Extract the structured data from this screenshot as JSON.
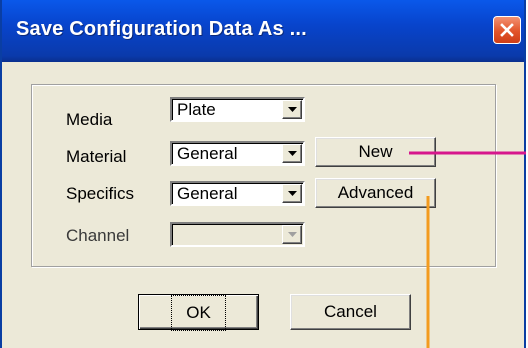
{
  "window": {
    "title": "Save Configuration Data As ..."
  },
  "form": {
    "media": {
      "label": "Media",
      "value": "Plate"
    },
    "material": {
      "label": "Material",
      "value": "General"
    },
    "specifics": {
      "label": "Specifics",
      "value": "General"
    },
    "channel": {
      "label": "Channel",
      "value": "",
      "disabled": true
    }
  },
  "buttons": {
    "new": "New",
    "advanced": "Advanced",
    "ok": "OK",
    "cancel": "Cancel"
  },
  "colors": {
    "callout_new": "#d6178d",
    "callout_advanced": "#f39b1e",
    "titlebar": "#0a4bd6",
    "close": "#e2542a"
  }
}
